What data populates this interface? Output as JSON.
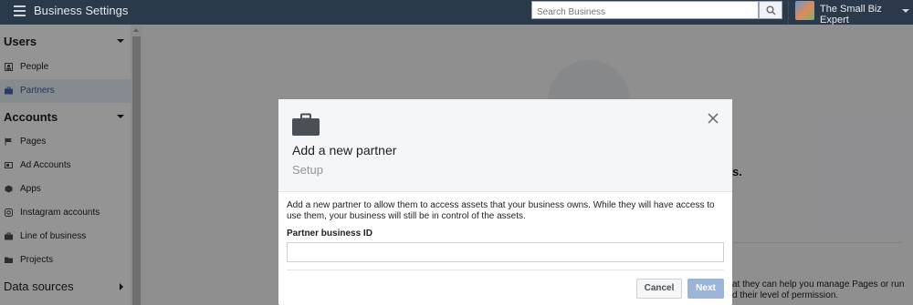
{
  "topbar": {
    "title": "Business Settings",
    "search_placeholder": "Search Business",
    "business_name": "The Small Biz Expert",
    "menu_icon": "hamburger-icon",
    "search_icon": "search-icon"
  },
  "sidebar": {
    "sections": [
      {
        "label": "Users",
        "expanded": true
      },
      {
        "label": "Accounts",
        "expanded": true
      },
      {
        "label": "Data sources",
        "expanded": false
      }
    ],
    "users_items": [
      {
        "label": "People",
        "icon": "person-icon"
      },
      {
        "label": "Partners",
        "icon": "briefcase-icon",
        "active": true
      }
    ],
    "accounts_items": [
      {
        "label": "Pages",
        "icon": "flag-icon"
      },
      {
        "label": "Ad Accounts",
        "icon": "ad-account-icon"
      },
      {
        "label": "Apps",
        "icon": "cube-icon"
      },
      {
        "label": "Instagram accounts",
        "icon": "instagram-icon"
      },
      {
        "label": "Line of business",
        "icon": "briefcase-icon"
      },
      {
        "label": "Projects",
        "icon": "folder-icon"
      }
    ]
  },
  "background": {
    "heading_fragment": "rs.",
    "para_fragment_1": "at they can help you manage Pages or run",
    "para_fragment_2": "d their level of permission."
  },
  "modal": {
    "title": "Add a new partner",
    "subtitle": "Setup",
    "description": "Add a new partner to allow them to access assets that your business owns. While they will have access to use them, your business will still be in control of the assets.",
    "field_label": "Partner business ID",
    "field_value": "",
    "cancel_label": "Cancel",
    "next_label": "Next",
    "accent_color": "#4267b2"
  }
}
